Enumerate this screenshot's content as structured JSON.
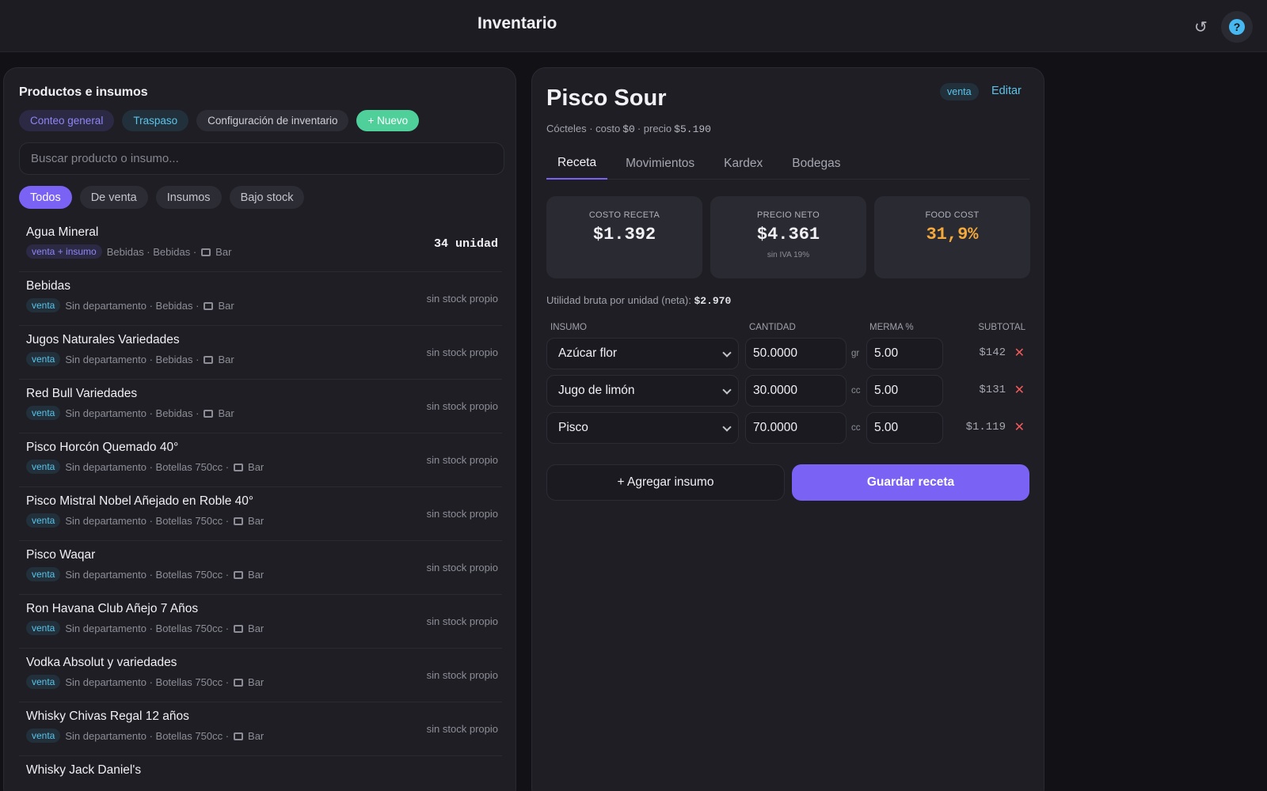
{
  "header": {
    "title": "Inventario",
    "refresh_icon": "↺",
    "help_icon": "?"
  },
  "left": {
    "title": "Productos e insumos",
    "actions": [
      "Conteo general",
      "Traspaso",
      "Configuración de inventario",
      "+ Nuevo"
    ],
    "search_placeholder": "Buscar producto o insumo...",
    "filters": [
      "Todos",
      "De venta",
      "Insumos",
      "Bajo stock"
    ],
    "active_filter": "Todos",
    "items": [
      {
        "name": "Agua Mineral",
        "tag": "venta + insumo",
        "meta": "Bebidas · Bebidas ·",
        "location": "Bar",
        "stock": "34 unidad"
      },
      {
        "name": "Bebidas",
        "tag": "venta",
        "meta": "Sin departamento · Bebidas ·",
        "location": "Bar",
        "stock": "sin stock propio"
      },
      {
        "name": "Jugos Naturales Variedades",
        "tag": "venta",
        "meta": "Sin departamento · Bebidas ·",
        "location": "Bar",
        "stock": "sin stock propio"
      },
      {
        "name": "Red Bull Variedades",
        "tag": "venta",
        "meta": "Sin departamento · Bebidas ·",
        "location": "Bar",
        "stock": "sin stock propio"
      },
      {
        "name": "Pisco Horcón Quemado 40°",
        "tag": "venta",
        "meta": "Sin departamento · Botellas 750cc ·",
        "location": "Bar",
        "stock": "sin stock propio"
      },
      {
        "name": "Pisco Mistral Nobel Añejado en Roble 40°",
        "tag": "venta",
        "meta": "Sin departamento · Botellas 750cc ·",
        "location": "Bar",
        "stock": "sin stock propio"
      },
      {
        "name": "Pisco Waqar",
        "tag": "venta",
        "meta": "Sin departamento · Botellas 750cc ·",
        "location": "Bar",
        "stock": "sin stock propio"
      },
      {
        "name": "Ron Havana Club Añejo 7 Años",
        "tag": "venta",
        "meta": "Sin departamento · Botellas 750cc ·",
        "location": "Bar",
        "stock": "sin stock propio"
      },
      {
        "name": "Vodka Absolut y variedades",
        "tag": "venta",
        "meta": "Sin departamento · Botellas 750cc ·",
        "location": "Bar",
        "stock": "sin stock propio"
      },
      {
        "name": "Whisky Chivas Regal 12 años",
        "tag": "venta",
        "meta": "Sin departamento · Botellas 750cc ·",
        "location": "Bar",
        "stock": "sin stock propio"
      },
      {
        "name": "Whisky Jack Daniel's",
        "tag": "",
        "meta": "",
        "location": "",
        "stock": ""
      }
    ]
  },
  "right": {
    "title": "Pisco Sour",
    "badge": "venta",
    "edit": "Editar",
    "sub": {
      "category": "Cócteles · costo",
      "cost": "$0",
      "sep": "· precio",
      "price": "$5.190"
    },
    "tabs": [
      "Receta",
      "Movimientos",
      "Kardex",
      "Bodegas"
    ],
    "active_tab": "Receta",
    "cards": [
      {
        "label": "COSTO RECETA",
        "value": "$1.392",
        "note": ""
      },
      {
        "label": "PRECIO NETO",
        "value": "$4.361",
        "note": "sin IVA 19%"
      },
      {
        "label": "FOOD COST",
        "value": "31,9%",
        "note": ""
      }
    ],
    "utility": {
      "label": "Utilidad bruta por unidad (neta):",
      "value": "$2.970"
    },
    "table_headers": [
      "INSUMO",
      "CANTIDAD",
      "MERMA %",
      "SUBTOTAL"
    ],
    "rows": [
      {
        "insumo": "Azúcar flor",
        "cantidad": "50.0000",
        "unit": "gr",
        "merma": "5.00",
        "subtotal": "$142"
      },
      {
        "insumo": "Jugo de limón",
        "cantidad": "30.0000",
        "unit": "cc",
        "merma": "5.00",
        "subtotal": "$131"
      },
      {
        "insumo": "Pisco",
        "cantidad": "70.0000",
        "unit": "cc",
        "merma": "5.00",
        "subtotal": "$1.119"
      }
    ],
    "add_button": "+ Agregar insumo",
    "save_button": "Guardar receta"
  },
  "colors": {
    "accent": "#7a62f5",
    "venta": "#5bc4ea",
    "success": "#4fd09a",
    "warning": "#f4a93a",
    "danger": "#f25a5a"
  }
}
